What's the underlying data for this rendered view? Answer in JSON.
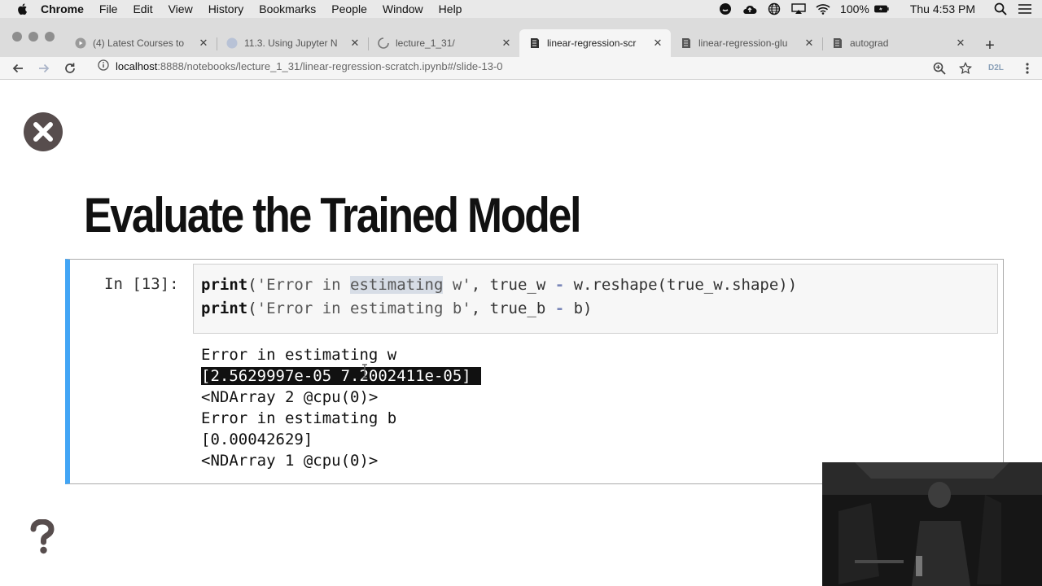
{
  "menubar": {
    "app_name": "Chrome",
    "menus": [
      "File",
      "Edit",
      "View",
      "History",
      "Bookmarks",
      "People",
      "Window",
      "Help"
    ],
    "battery": "100%",
    "clock": "Thu 4:53 PM"
  },
  "tabs": [
    {
      "title": "(4) Latest Courses to",
      "icon": "youtube-icon"
    },
    {
      "title": "11.3. Using Jupyter N",
      "icon": "globe-icon"
    },
    {
      "title": "lecture_1_31/",
      "icon": "loading-spinner-icon"
    },
    {
      "title": "linear-regression-scr",
      "icon": "notebook-icon",
      "active": true
    },
    {
      "title": "linear-regression-glu",
      "icon": "notebook-icon"
    },
    {
      "title": "autograd",
      "icon": "notebook-icon"
    }
  ],
  "toolbar": {
    "url_host": "localhost",
    "url_path": ":8888/notebooks/lecture_1_31/linear-regression-scratch.ipynb#/slide-13-0",
    "extension_label": "D2L"
  },
  "slide": {
    "title": "Evaluate the Trained Model"
  },
  "cell": {
    "prompt": "In [13]:",
    "code": {
      "line1": {
        "kw": "print",
        "open": "(",
        "str_a": "'Error in ",
        "str_hl": "estimating",
        "str_b": " w'",
        "mid": ", true_w ",
        "op": "-",
        "rest": " w.reshape(true_w.shape))"
      },
      "line2": {
        "kw": "print",
        "open": "(",
        "str": "'Error in estimating b'",
        "mid": ", true_b ",
        "op": "-",
        "rest": " b)"
      }
    },
    "output": [
      "Error in estimating w",
      "[2.5629997e-05 7.2002411e-05]",
      "<NDArray 2 @cpu(0)>",
      "Error in estimating b",
      "[0.00042629]",
      "<NDArray 1 @cpu(0)>"
    ]
  }
}
